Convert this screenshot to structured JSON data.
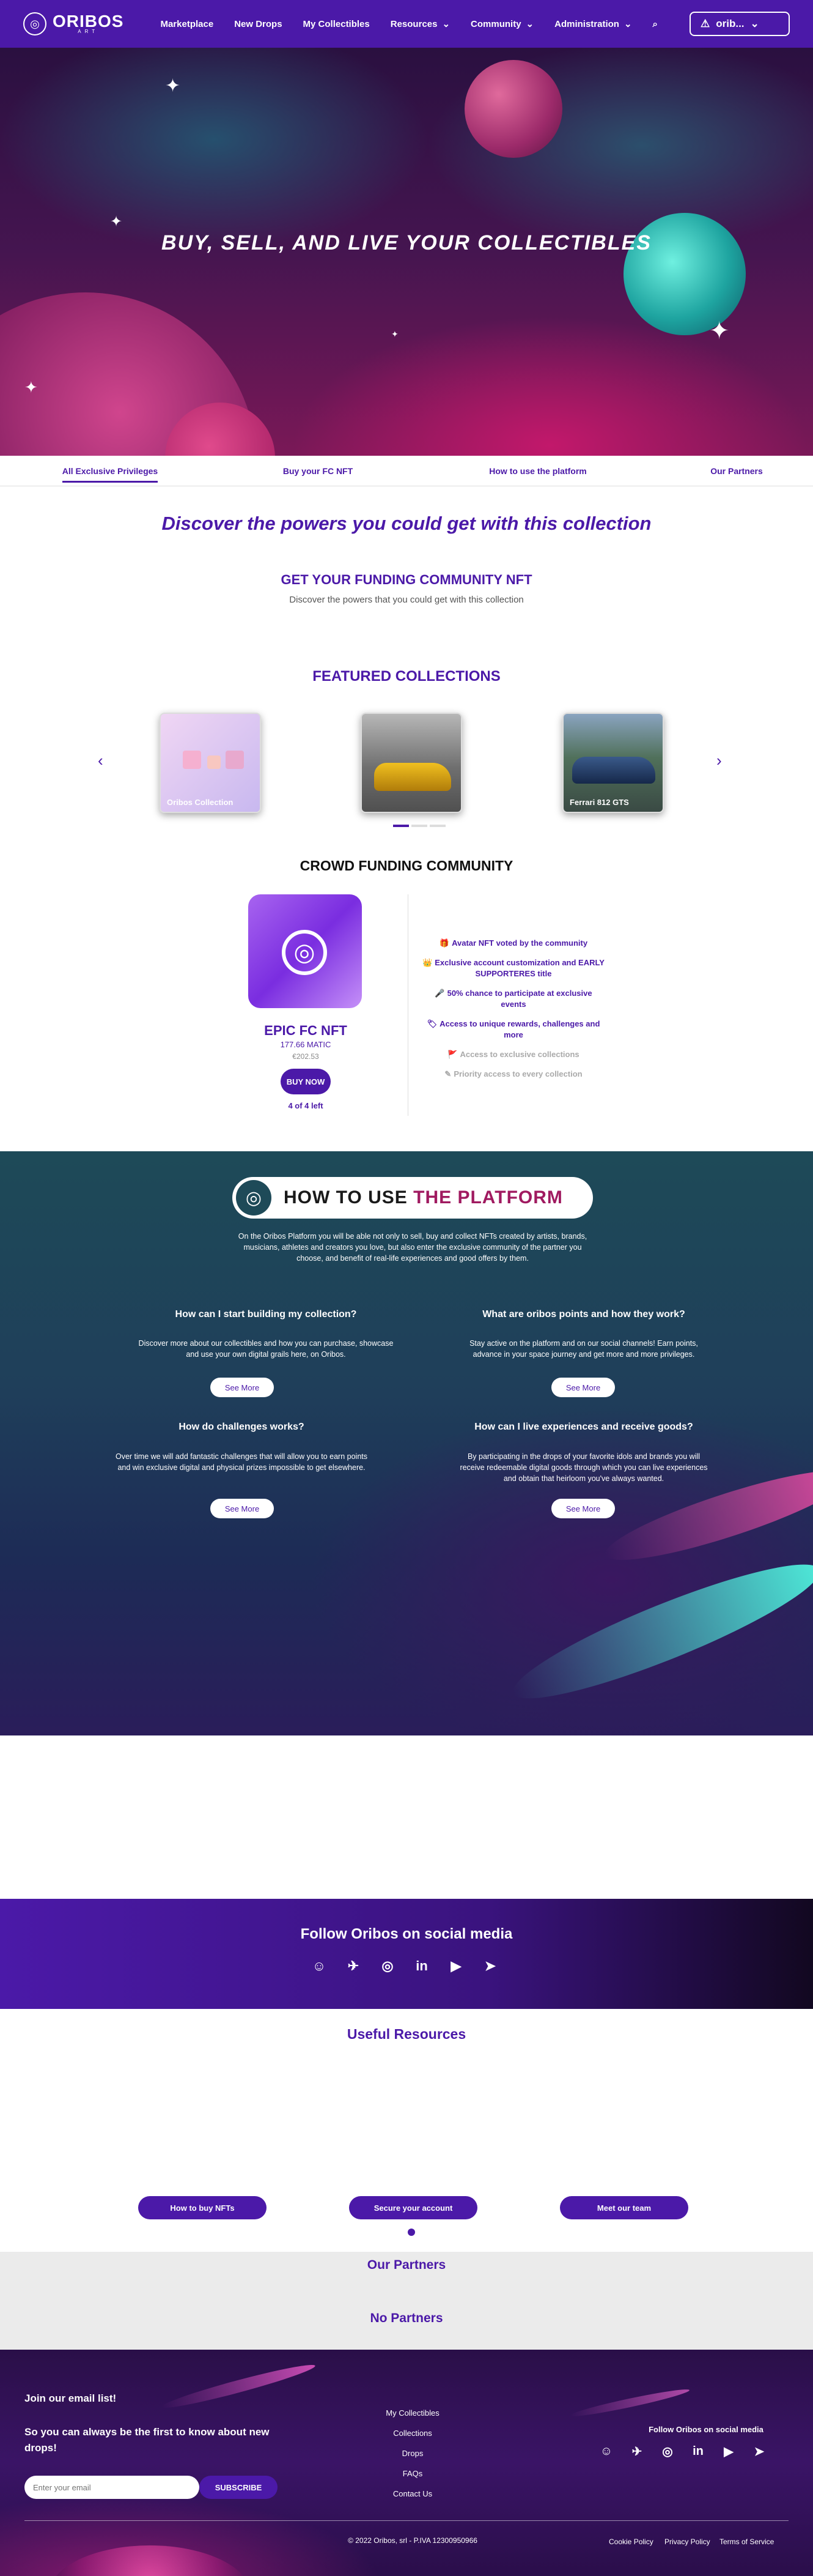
{
  "nav": {
    "logo_text": "ORIBOS",
    "logo_sub": "ART",
    "links": [
      "Marketplace",
      "New Drops",
      "My Collectibles",
      "Resources",
      "Community",
      "Administration"
    ],
    "wallet_label": "orib..."
  },
  "hero": {
    "title": "BUY, SELL, AND LIVE YOUR COLLECTIBLES"
  },
  "tabs": [
    "All Exclusive Privileges",
    "Buy your FC NFT",
    "How to use the platform",
    "Our Partners"
  ],
  "intro": {
    "headline": "Discover the powers you could get with this collection",
    "subheadline": "GET YOUR FUNDING COMMUNITY NFT",
    "description": "Discover the powers that you could get with this collection"
  },
  "featured": {
    "title": "FEATURED COLLECTIONS",
    "cards": [
      {
        "label": "Oribos Collection"
      },
      {
        "label": ""
      },
      {
        "label": "Ferrari 812 GTS"
      }
    ],
    "prev": "‹",
    "next": "›"
  },
  "crowd": {
    "title": "CROWD FUNDING COMMUNITY",
    "nft_name": "EPIC FC NFT",
    "price_matic": "177.66 MATIC",
    "price_eur": "€202.53",
    "buy_label": "BUY NOW",
    "availability": "4 of 4 left",
    "perks": [
      {
        "text": "Avatar NFT voted by the community",
        "icon": "🎁",
        "active": true
      },
      {
        "text": "Exclusive account customization and EARLY SUPPORTERES title",
        "icon": "👑",
        "active": true
      },
      {
        "text": "50% chance to participate at exclusive events",
        "icon": "🎤",
        "active": true
      },
      {
        "text": "Access to unique rewards, challenges and more",
        "icon": "🏷",
        "active": true
      },
      {
        "text": "Access to exclusive collections",
        "icon": "🚩",
        "active": false
      },
      {
        "text": "Priority access to every collection",
        "icon": "✎",
        "active": false
      }
    ]
  },
  "howto": {
    "title_a": "HOW TO USE",
    "title_b": "THE PLATFORM",
    "intro": "On the Oribos Platform you will be able not only to sell, buy and collect NFTs created by artists, brands, musicians, athletes and creators you love, but also enter the exclusive community of the partner you choose, and benefit of real-life experiences and good offers by them.",
    "qa": [
      {
        "q": "How can I start building my collection?",
        "a": "Discover more about our collectibles and how you can purchase, showcase and use your own digital grails here, on Oribos."
      },
      {
        "q": "What are oribos points and how they work?",
        "a": "Stay active on the platform and on our social channels! Earn points, advance in your space journey and get more and more privileges."
      },
      {
        "q": "How do challenges works?",
        "a": "Over time we will add fantastic challenges that will allow you to earn points and win exclusive digital and physical prizes impossible to get elsewhere."
      },
      {
        "q": "How can I live experiences and receive goods?",
        "a": "By participating in the drops of your favorite idols and brands you will receive redeemable digital goods through which you can live experiences and obtain that heirloom you've always wanted."
      }
    ],
    "see_more": "See More"
  },
  "social": {
    "title": "Follow Oribos on social media",
    "icons": [
      "discord-icon",
      "twitter-icon",
      "instagram-icon",
      "linkedin-icon",
      "youtube-icon",
      "telegram-icon"
    ]
  },
  "resources": {
    "title": "Useful Resources",
    "buttons": [
      "How to buy NFTs",
      "Secure your account",
      "Meet our team"
    ]
  },
  "partners": {
    "title": "Our Partners",
    "empty": "No Partners"
  },
  "footer": {
    "email_title": "Join our email list!",
    "email_sub": "So you can always be the first to know about new drops!",
    "email_placeholder": "Enter your email",
    "subscribe": "SUBSCRIBE",
    "links": [
      "My Collectibles",
      "Collections",
      "Drops",
      "FAQs",
      "Contact Us"
    ],
    "social_title": "Follow Oribos on social media",
    "copyright": "© 2022 Oribos, srl - P.IVA 12300950966",
    "legal": [
      "Cookie Policy",
      "Privacy Policy",
      "Terms of Service"
    ]
  }
}
